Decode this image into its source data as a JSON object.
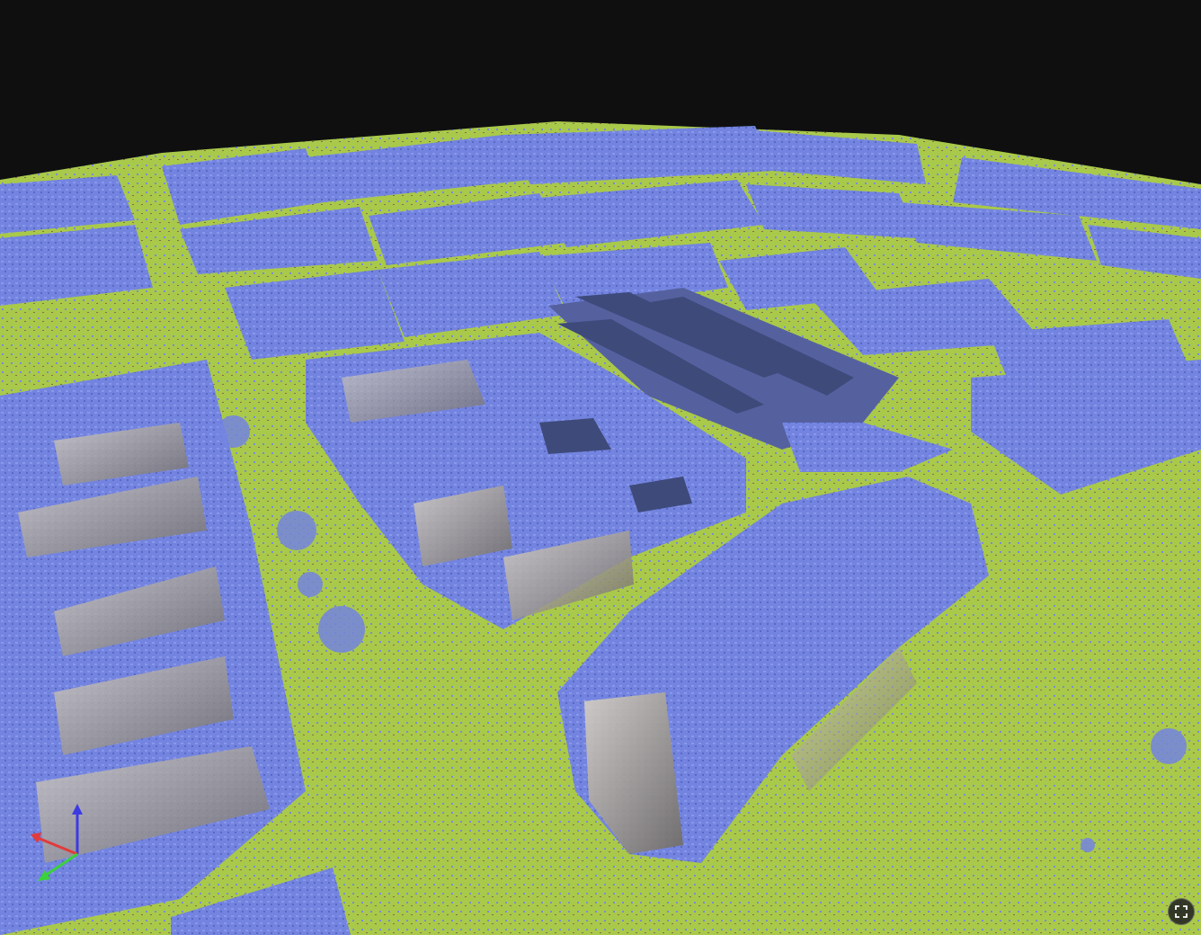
{
  "viewer": {
    "colors": {
      "background": "#0f0f10",
      "ground": "#a9c94a",
      "ground_dark": "#8fae36",
      "building_points": "#7384e0",
      "building_shadow": "#4e5aa8",
      "roof_panels": "#3e4a7a",
      "wall": "#b9b2a6",
      "soil": "#8a6a4a"
    },
    "axes": {
      "x_color": "#e23b3b",
      "y_color": "#3bd13b",
      "z_color": "#3b3be2"
    },
    "controls": {
      "fullscreen_icon": "fullscreen-icon"
    }
  }
}
